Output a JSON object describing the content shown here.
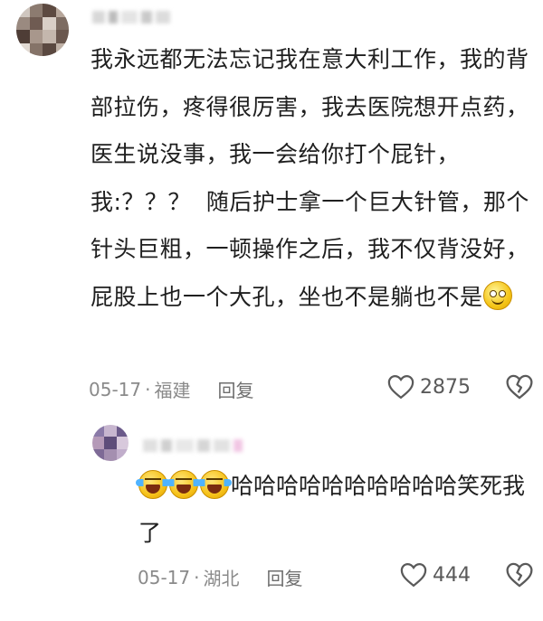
{
  "comment": {
    "text": "我永远都无法忘记我在意大利工作，我的背部拉伤，疼得很厉害，我去医院想开点药，医生说没事，我一会给你打个屁针，我:？？？  随后护士拿一个巨大针管，那个针头巨粗，一顿操作之后，我不仅背没好，屁股上也一个大孔，坐也不是躺也不是",
    "emoji": "smile-emoji",
    "date": "05-17",
    "dot": "·",
    "location": "福建",
    "reply_label": "回复",
    "likes": "2875"
  },
  "reply": {
    "text": "哈哈哈哈哈哈哈哈哈哈笑死我了",
    "emojis": [
      "laugh-cry-emoji",
      "laugh-cry-emoji",
      "laugh-cry-emoji"
    ],
    "date": "05-17",
    "dot": "·",
    "location": "湖北",
    "reply_label": "回复",
    "likes": "444"
  },
  "colors": {
    "text": "#1f1f1f",
    "meta": "#8a8a8a",
    "icon": "#5a5a5a"
  }
}
